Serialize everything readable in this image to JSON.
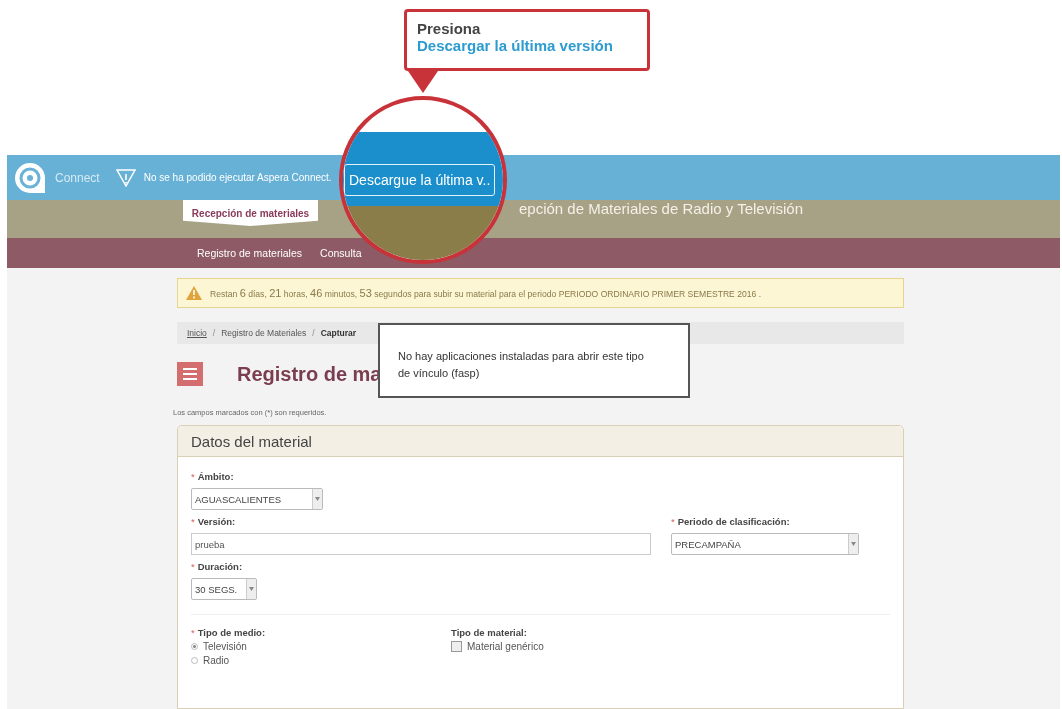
{
  "callout": {
    "title": "Presiona",
    "link": "Descargar la última versión"
  },
  "connect_bar": {
    "brand": "Connect",
    "message": "No se ha podido ejecutar Aspera Connect.",
    "button": "Descargue la última v.."
  },
  "header": {
    "tab": "Recepción de materiales",
    "title": "epción de Materiales de Radio y Televisión"
  },
  "nav": [
    {
      "label": "Registro de materiales"
    },
    {
      "label": "Consulta"
    }
  ],
  "alert": {
    "segments": [
      {
        "kind": "text",
        "text": "Restan"
      },
      {
        "kind": "number",
        "text": "6"
      },
      {
        "kind": "text",
        "text": "días,"
      },
      {
        "kind": "number",
        "text": "21"
      },
      {
        "kind": "text",
        "text": "horas,"
      },
      {
        "kind": "number",
        "text": "46"
      },
      {
        "kind": "text",
        "text": "minutos,"
      },
      {
        "kind": "number",
        "text": "53"
      },
      {
        "kind": "text",
        "text": "segundos para subir su material para el periodo PERIODO ORDINARIO PRIMER SEMESTRE 2016 ."
      }
    ]
  },
  "breadcrumb_separator": "/",
  "breadcrumb": [
    {
      "kind": "link",
      "label": "Inicio"
    },
    {
      "kind": "text",
      "label": "Registro de Materiales"
    },
    {
      "kind": "current",
      "label": "Capturar"
    }
  ],
  "page_title": "Registro de ma",
  "dialog": {
    "message": "No hay aplicaciones instaladas para abrir este tipo de vínculo (fasp)"
  },
  "required_note": "Los campos marcados con (*) son requeridos.",
  "panel": {
    "title": "Datos del material",
    "rows": [
      [
        {
          "kind": "select",
          "mark": "*",
          "label": "Ámbito:",
          "value": "AGUASCALIENTES"
        }
      ],
      [
        {
          "kind": "input",
          "mark": "*",
          "label": "Versión:",
          "value": "prueba"
        },
        {
          "kind": "select",
          "mark": "*",
          "label": "Periodo de clasificación:",
          "value": "PRECAMPAÑA"
        }
      ],
      [
        {
          "kind": "select",
          "mark": "*",
          "label": "Duración:",
          "value": "30 SEGS."
        }
      ]
    ],
    "medio": {
      "mark": "*",
      "label": "Tipo de medio:",
      "options": [
        {
          "label": "Televisión",
          "selected": true
        },
        {
          "label": "Radio",
          "selected": false
        }
      ]
    },
    "material": {
      "label": "Tipo de material:",
      "options": [
        {
          "label": "Material genérico",
          "checked": false
        }
      ]
    }
  }
}
